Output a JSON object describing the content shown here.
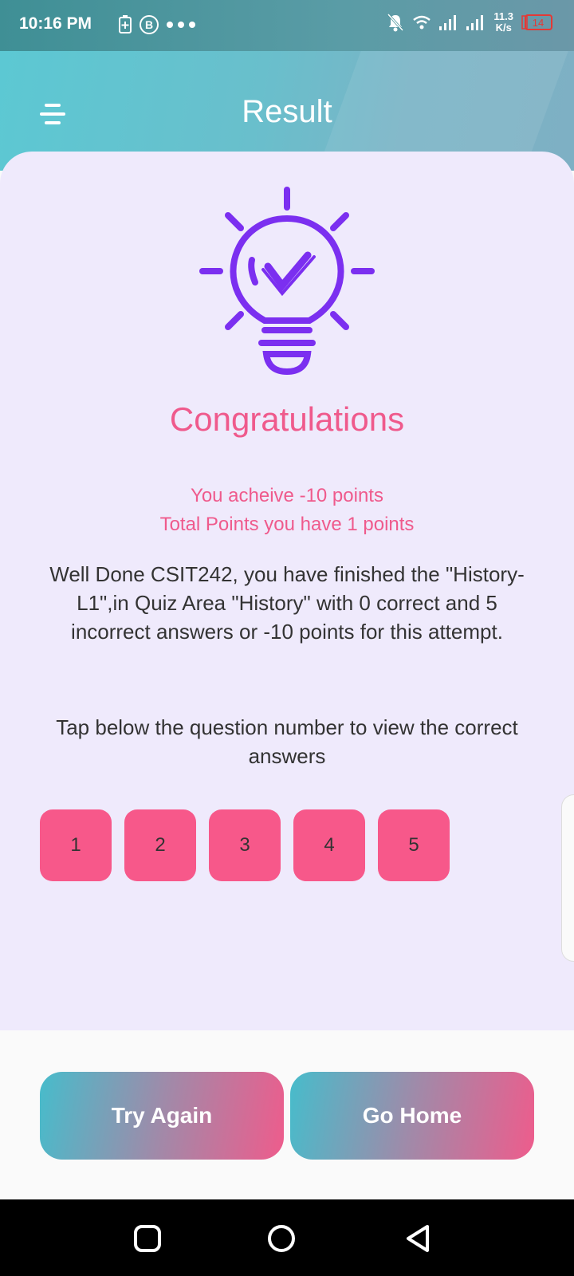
{
  "status_bar": {
    "time": "10:16 PM",
    "net_speed_value": "11.3",
    "net_speed_unit": "K/s",
    "battery_level": "14",
    "left_icons": [
      "battery-saver-icon",
      "b-badge-icon",
      "more-dots-icon"
    ],
    "right_icons": [
      "mute-bell-icon",
      "wifi-icon",
      "signal-icon",
      "signal-icon-2",
      "battery-icon"
    ]
  },
  "header": {
    "title": "Result",
    "menu_icon": "menu-icon"
  },
  "result": {
    "heading": "Congratulations",
    "points_line_1": "You acheive -10 points",
    "points_line_2": "Total Points you have 1 points",
    "summary": "Well Done CSIT242, you have finished the \"History-L1\",in Quiz Area \"History\" with 0 correct and 5 incorrect answers or -10 points for this attempt.",
    "tap_hint": "Tap below the question number to  view the correct answers",
    "questions": [
      "1",
      "2",
      "3",
      "4",
      "5"
    ]
  },
  "actions": {
    "try_again": "Try Again",
    "go_home": "Go Home"
  },
  "nav": {
    "icons": [
      "recents-square-icon",
      "home-circle-icon",
      "back-triangle-icon"
    ]
  },
  "colors": {
    "accent_pink": "#ef5a8c",
    "button_pink": "#f7588a",
    "teal": "#5cc8d3",
    "purple_icon": "#7b2ff0",
    "card_bg": "#efeafc"
  }
}
